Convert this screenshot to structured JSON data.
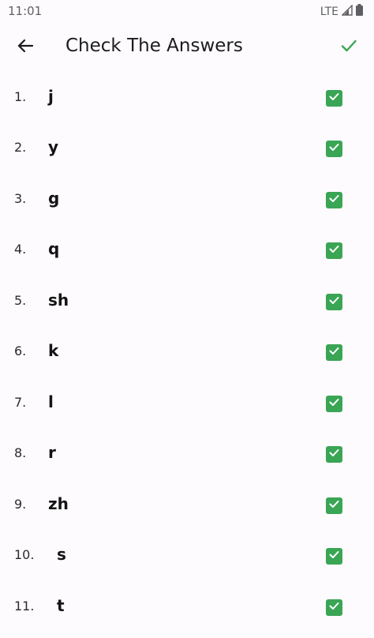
{
  "status_bar": {
    "time": "11:01",
    "network": "LTE",
    "icons": [
      "signal-icon",
      "battery-icon"
    ]
  },
  "app_bar": {
    "title": "Check The Answers",
    "back_icon": "arrow-left-icon",
    "confirm_icon": "check-icon"
  },
  "colors": {
    "accent": "#3aa555",
    "background": "#fdfbfd"
  },
  "answers": [
    {
      "number": "1.",
      "text": "j",
      "checked": true
    },
    {
      "number": "2.",
      "text": "y",
      "checked": true
    },
    {
      "number": "3.",
      "text": "g",
      "checked": true
    },
    {
      "number": "4.",
      "text": "q",
      "checked": true
    },
    {
      "number": "5.",
      "text": "sh",
      "checked": true
    },
    {
      "number": "6.",
      "text": "k",
      "checked": true
    },
    {
      "number": "7.",
      "text": "l",
      "checked": true
    },
    {
      "number": "8.",
      "text": "r",
      "checked": true
    },
    {
      "number": "9.",
      "text": "zh",
      "checked": true
    },
    {
      "number": "10.",
      "text": "s",
      "checked": true
    },
    {
      "number": "11.",
      "text": "t",
      "checked": true
    }
  ]
}
